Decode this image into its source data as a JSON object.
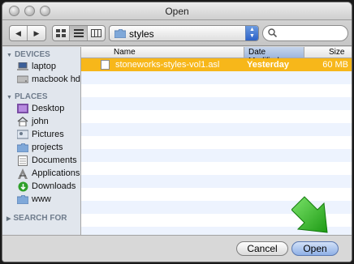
{
  "window": {
    "title": "Open"
  },
  "toolbar": {
    "back_glyph": "◀",
    "forward_glyph": "▶",
    "path": "styles",
    "search_value": "",
    "search_placeholder": ""
  },
  "sidebar": {
    "devices_header": "DEVICES",
    "devices": [
      {
        "label": "laptop",
        "icon": "laptop-icon"
      },
      {
        "label": "macbook hd",
        "icon": "hard-drive-icon"
      }
    ],
    "places_header": "PLACES",
    "places": [
      {
        "label": "Desktop",
        "icon": "desktop-icon"
      },
      {
        "label": "john",
        "icon": "home-icon"
      },
      {
        "label": "Pictures",
        "icon": "pictures-icon"
      },
      {
        "label": "projects",
        "icon": "folder-icon"
      },
      {
        "label": "Documents",
        "icon": "documents-icon"
      },
      {
        "label": "Applications",
        "icon": "applications-icon"
      },
      {
        "label": "Downloads",
        "icon": "downloads-icon"
      },
      {
        "label": "www",
        "icon": "folder-icon"
      }
    ],
    "search_header": "SEARCH FOR"
  },
  "columns": {
    "name": "Name",
    "date": "Date Modified",
    "size": "Size"
  },
  "files": [
    {
      "name": "stoneworks-styles-vol1.asl",
      "date": "Yesterday",
      "size": "60 MB",
      "selected": true
    }
  ],
  "buttons": {
    "cancel": "Cancel",
    "open": "Open"
  },
  "colors": {
    "selection": "#f7b71a",
    "stripe": "#edf3fe",
    "sidebar": "#e1e6ed",
    "arrow": "#2fc41e"
  }
}
